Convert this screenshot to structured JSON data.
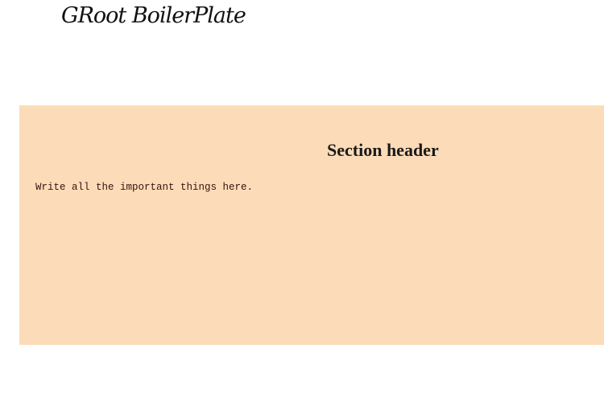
{
  "header": {
    "title": "GRoot BoilerPlate"
  },
  "section": {
    "heading": "Section header",
    "body_text": "Write all the important things here.",
    "background_color": "#fcdcb8"
  }
}
